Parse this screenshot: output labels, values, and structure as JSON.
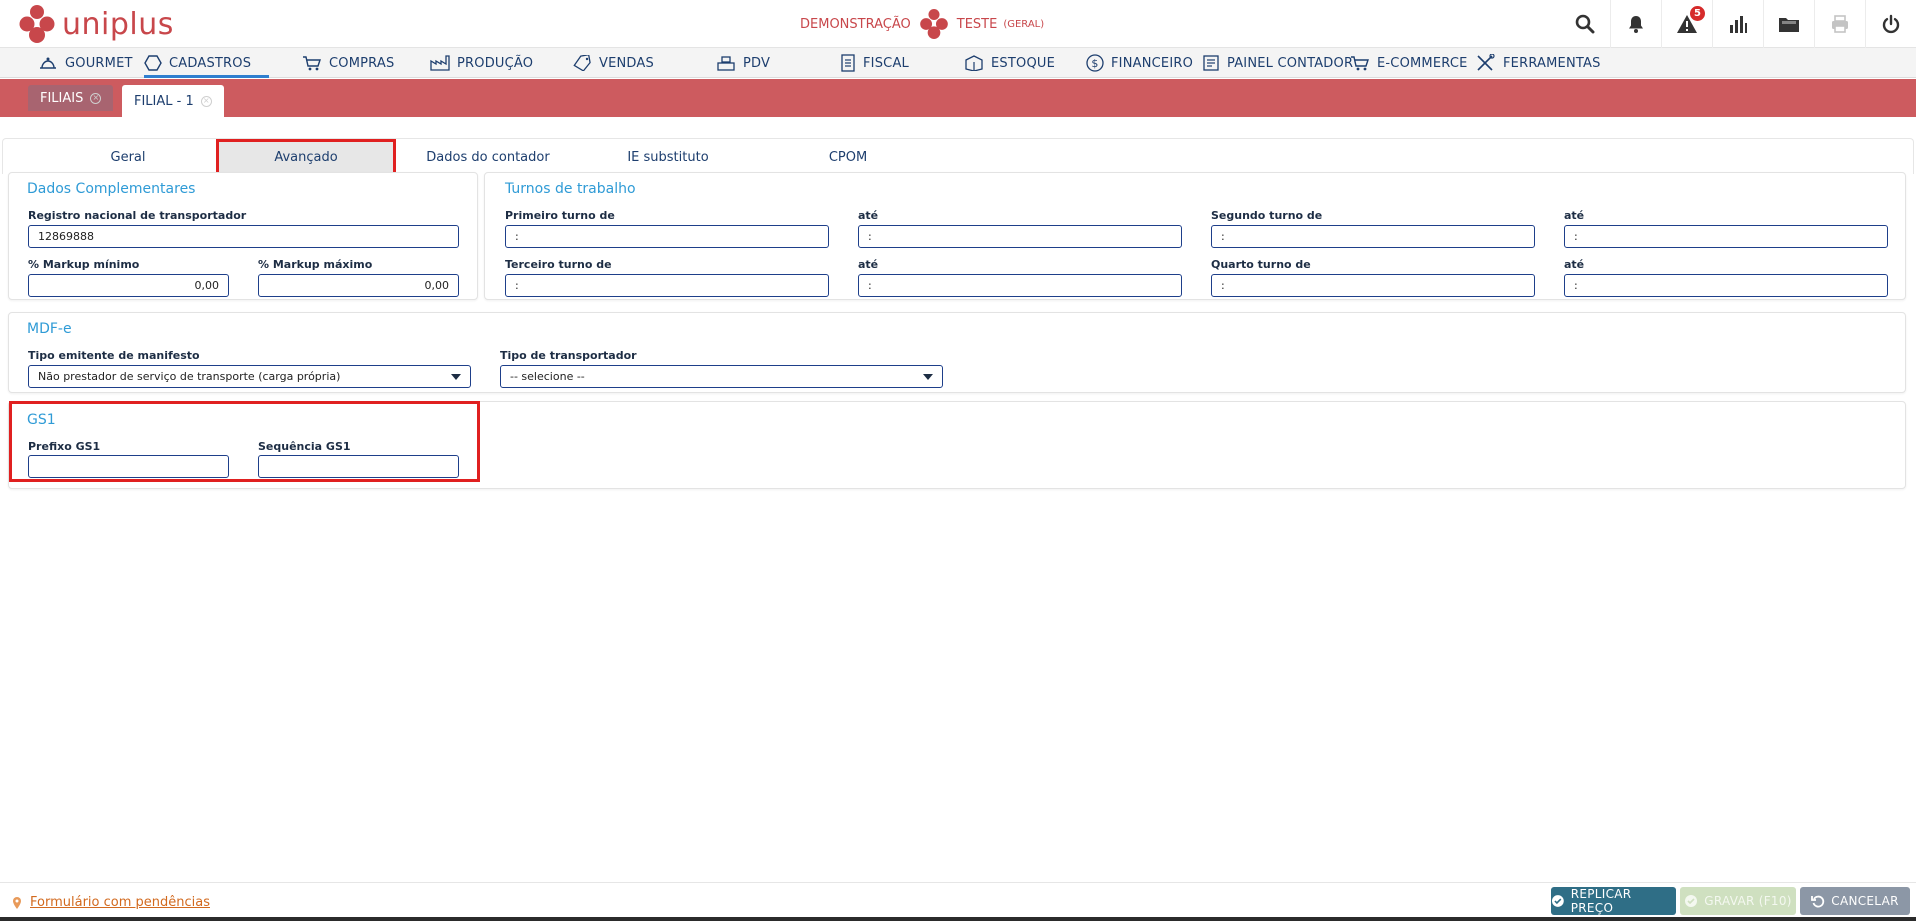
{
  "header": {
    "brand": "uniplus",
    "company": "DEMONSTRAÇÃO",
    "user": "TESTE",
    "user_role": "(GERAL)",
    "alert_count": "5"
  },
  "menu": [
    {
      "label": "GOURMET",
      "icon": "gourmet-icon"
    },
    {
      "label": "CADASTROS",
      "icon": "hexagon-icon"
    },
    {
      "label": "COMPRAS",
      "icon": "cart-icon"
    },
    {
      "label": "PRODUÇÃO",
      "icon": "factory-icon"
    },
    {
      "label": "VENDAS",
      "icon": "tag-icon"
    },
    {
      "label": "PDV",
      "icon": "register-icon"
    },
    {
      "label": "FISCAL",
      "icon": "document-icon"
    },
    {
      "label": "ESTOQUE",
      "icon": "box-icon"
    },
    {
      "label": "FINANCEIRO",
      "icon": "dollar-icon"
    },
    {
      "label": "PAINEL CONTADOR",
      "icon": "panel-icon"
    },
    {
      "label": "E-COMMERCE",
      "icon": "ecommerce-cart-icon"
    },
    {
      "label": "FERRAMENTAS",
      "icon": "tools-icon"
    }
  ],
  "doc_tabs": [
    {
      "label": "FILIAIS"
    },
    {
      "label": "FILIAL - 1"
    }
  ],
  "subtabs": [
    "Geral",
    "Avançado",
    "Dados do contador",
    "IE substituto",
    "CPOM"
  ],
  "dados_complementares": {
    "title": "Dados Complementares",
    "rntrc_label": "Registro nacional de transportador",
    "rntrc_value": "12869888",
    "markup_min_label": "% Markup mínimo",
    "markup_min_value": "0,00",
    "markup_max_label": "% Markup máximo",
    "markup_max_value": "0,00"
  },
  "turnos": {
    "title": "Turnos de trabalho",
    "primeiro_label": "Primeiro turno de",
    "ate1_label": "até",
    "segundo_label": "Segundo turno de",
    "ate2_label": "até",
    "terceiro_label": "Terceiro turno de",
    "ate3_label": "até",
    "quarto_label": "Quarto turno de",
    "ate4_label": "até",
    "time_placeholder": ":"
  },
  "mdfe": {
    "title": "MDF-e",
    "emitente_label": "Tipo emitente de manifesto",
    "emitente_value": "Não prestador de serviço de transporte (carga própria)",
    "transportador_label": "Tipo de transportador",
    "transportador_value": "-- selecione --"
  },
  "gs1": {
    "title": "GS1",
    "prefixo_label": "Prefixo GS1",
    "prefixo_value": "",
    "sequencia_label": "Sequência GS1",
    "sequencia_value": ""
  },
  "footer": {
    "pendencias": "Formulário com pendências",
    "replicar": "REPLICAR PREÇO",
    "gravar": "GRAVAR (F10)",
    "cancelar": "CANCELAR"
  },
  "colors": {
    "brand": "#c8474b",
    "band": "#cd5b5f",
    "accent_blue": "#2f9bd6",
    "highlight": "#e02020"
  }
}
